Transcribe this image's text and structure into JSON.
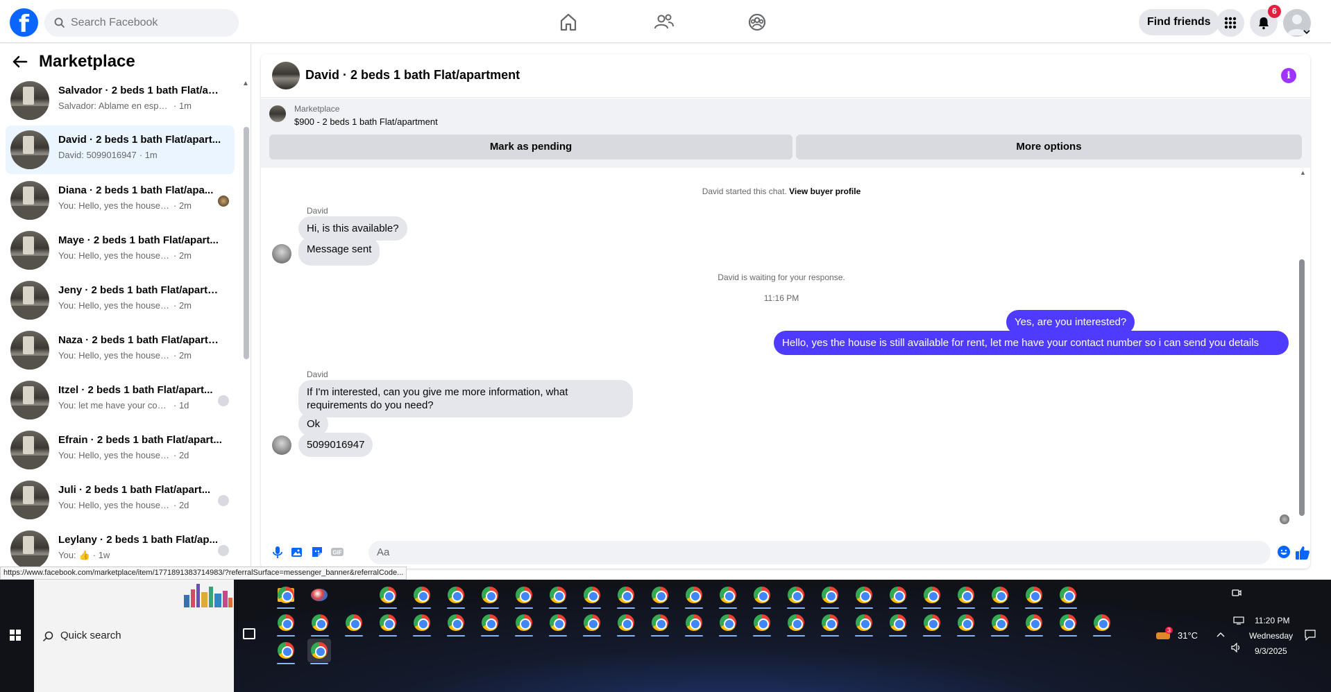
{
  "topbar": {
    "search_placeholder": "Search Facebook",
    "find_friends": "Find friends",
    "notification_count": "6"
  },
  "sidebar": {
    "title": "Marketplace",
    "conversations": [
      {
        "title": "Salvador · 2 beds 1 bath Flat/apa...",
        "preview": "Salvador: Ablame en español",
        "time": "· 1m"
      },
      {
        "title": "David · 2 beds 1 bath Flat/apart...",
        "preview": "David: 5099016947",
        "time": "· 1m"
      },
      {
        "title": "Diana · 2 beds 1 bath Flat/apa...",
        "preview": "You: Hello, yes the house is still ...",
        "time": "· 2m"
      },
      {
        "title": "Maye · 2 beds 1 bath Flat/apart...",
        "preview": "You: Hello, yes the house is still av...",
        "time": "· 2m"
      },
      {
        "title": "Jeny · 2 beds 1 bath Flat/apartm...",
        "preview": "You: Hello, yes the house is still av...",
        "time": "· 2m"
      },
      {
        "title": "Naza · 2 beds 1 bath Flat/apartm...",
        "preview": "You: Hello, yes the house is still av...",
        "time": "· 2m"
      },
      {
        "title": "Itzel · 2 beds 1 bath Flat/apart...",
        "preview": "You: let me have your contact n...",
        "time": "· 1d"
      },
      {
        "title": "Efrain · 2 beds 1 bath Flat/apart...",
        "preview": "You: Hello, yes the house is still ava...",
        "time": "· 2d"
      },
      {
        "title": "Juli · 2 beds 1 bath Flat/apart...",
        "preview": "You: Hello, yes the house is still ...",
        "time": "· 2d"
      },
      {
        "title": "Leylany · 2 beds 1 bath Flat/ap...",
        "preview": "You:",
        "time": "· 1w"
      }
    ]
  },
  "chat": {
    "title": "David · 2 beds 1 bath Flat/apartment",
    "listing_label": "Marketplace",
    "listing_price": "$900 - 2 beds 1 bath Flat/apartment",
    "mark_pending": "Mark as pending",
    "more_options": "More options",
    "started_text": "David started this chat.",
    "view_profile": "View buyer profile",
    "sender1": "David",
    "msg1": "Hi, is this available?",
    "msg2": "Message sent",
    "waiting": "David is waiting for your response.",
    "time": "11:16 PM",
    "out1": "Yes, are you interested?",
    "out2": "Hello, yes the house is still available for rent, let me have your contact number so i can send you details",
    "sender2": "David",
    "msg3": "If I'm interested, can you give me more information, what requirements do you need?",
    "msg4": "Ok",
    "msg5": "5099016947",
    "composer_placeholder": "Aa"
  },
  "status_url": "https://www.facebook.com/marketplace/item/1771891383714983/?referralSurface=messenger_banner&referralCode...",
  "taskbar": {
    "quick_search": "Quick search",
    "weather": "31°C",
    "weather_badge": "3",
    "time": "11:20 PM",
    "day": "Wednesday",
    "date": "9/3/2025"
  },
  "colors": {
    "facebook_blue": "#0866ff",
    "outgoing_bubble": "#4f3bff",
    "incoming_bubble": "#e4e6eb",
    "active_conversation": "#ebf5ff"
  }
}
